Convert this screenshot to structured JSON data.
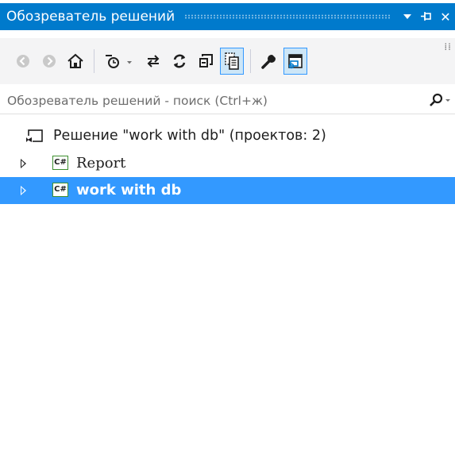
{
  "window": {
    "title": "Обозреватель решений",
    "accent_color": "#007acc",
    "dropdown_icon": "chevron-down-icon",
    "pin_icon": "pin-icon",
    "close_icon": "close-icon",
    "close_glyph": "✕"
  },
  "toolbar": {
    "overflow_glyph": "⁞⁞",
    "buttons": [
      {
        "name": "back-icon",
        "enabled": false
      },
      {
        "name": "forward-icon",
        "enabled": false
      },
      {
        "name": "home-icon"
      },
      {
        "name": "pending-changes-filter-icon"
      },
      {
        "name": "sync-with-active-document-icon"
      },
      {
        "name": "refresh-icon"
      },
      {
        "name": "collapse-all-icon"
      },
      {
        "name": "show-all-files-icon",
        "active": true
      },
      {
        "name": "properties-icon"
      },
      {
        "name": "preview-selected-items-icon",
        "active": true
      }
    ]
  },
  "search": {
    "placeholder": "Обозреватель решений - поиск (Ctrl+ж)",
    "icon": "search-icon"
  },
  "tree": {
    "solution": {
      "label": "Решение \"work with db\"  (проектов: 2)",
      "icon": "solution-icon"
    },
    "projects": [
      {
        "label": "Report",
        "icon_text": "C#",
        "selected": false
      },
      {
        "label": "work with db",
        "icon_text": "C#",
        "selected": true
      }
    ],
    "selection_color": "#3399ff"
  }
}
